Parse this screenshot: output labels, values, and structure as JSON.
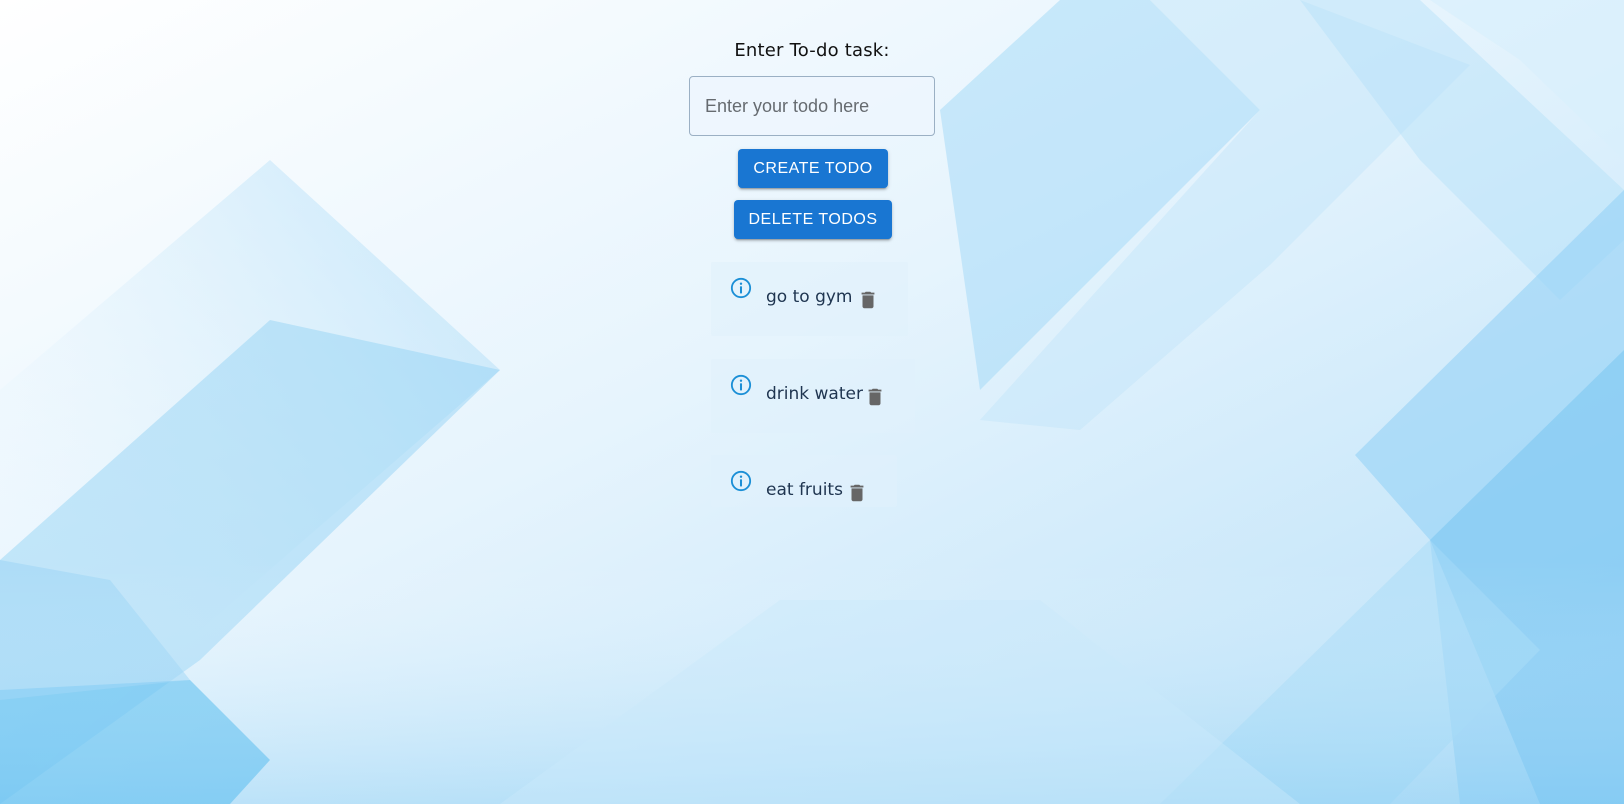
{
  "form": {
    "label": "Enter To-do task:",
    "input_placeholder": "Enter your todo here",
    "input_value": "",
    "create_button": "CREATE TODO",
    "delete_button": "DELETE TODOS"
  },
  "todos": [
    {
      "text": "go to gym",
      "info_icon": "info-circle-icon",
      "delete_icon": "trash-icon"
    },
    {
      "text": "drink water",
      "info_icon": "info-circle-icon",
      "delete_icon": "trash-icon"
    },
    {
      "text": "eat fruits",
      "info_icon": "info-circle-icon",
      "delete_icon": "trash-icon"
    }
  ],
  "colors": {
    "primary": "#1976d2",
    "info_icon": "#1b8fd6",
    "trash_icon": "#666666",
    "background_accent": "#5cbef0"
  }
}
